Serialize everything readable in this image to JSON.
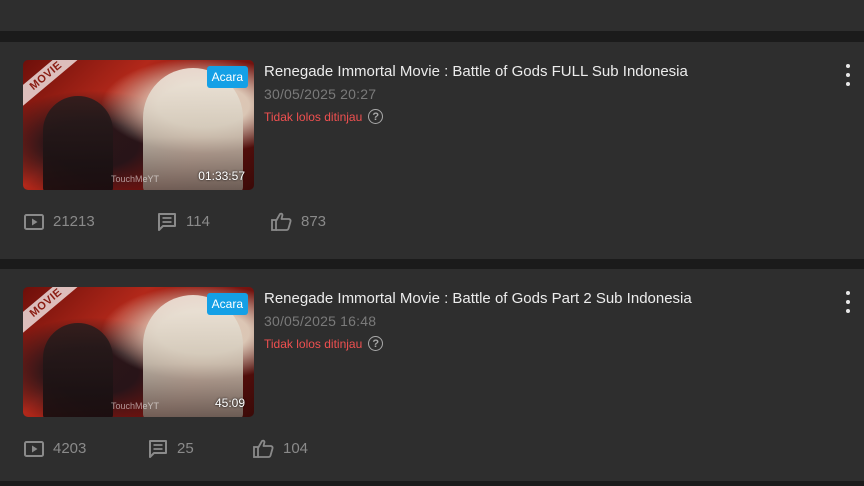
{
  "videos": [
    {
      "title": "Renegade Immortal Movie : Battle of Gods FULL Sub Indonesia",
      "datetime": "30/05/2025  20:27",
      "review_status": "Tidak lolos ditinjau",
      "badge": "Acara",
      "duration": "01:33:57",
      "ribbon": "MOVIE",
      "watermark": "TouchMeYT",
      "views": "21213",
      "comments": "114",
      "likes": "873"
    },
    {
      "title": "Renegade Immortal Movie : Battle of Gods Part 2 Sub Indonesia",
      "datetime": "30/05/2025  16:48",
      "review_status": "Tidak lolos ditinjau",
      "badge": "Acara",
      "duration": "45:09",
      "ribbon": "MOVIE",
      "watermark": "TouchMeYT",
      "views": "4203",
      "comments": "25",
      "likes": "104"
    }
  ],
  "colors": {
    "background": "#1b1b1b",
    "card": "#2e2e2e",
    "badge": "#14a0e6",
    "review_status": "#f05050",
    "muted": "#8a8a8a"
  },
  "icons": {
    "views": "play-box-icon",
    "comments": "comment-icon",
    "likes": "thumbs-up-icon",
    "help": "question-circle-icon",
    "menu": "more-vertical-icon"
  }
}
